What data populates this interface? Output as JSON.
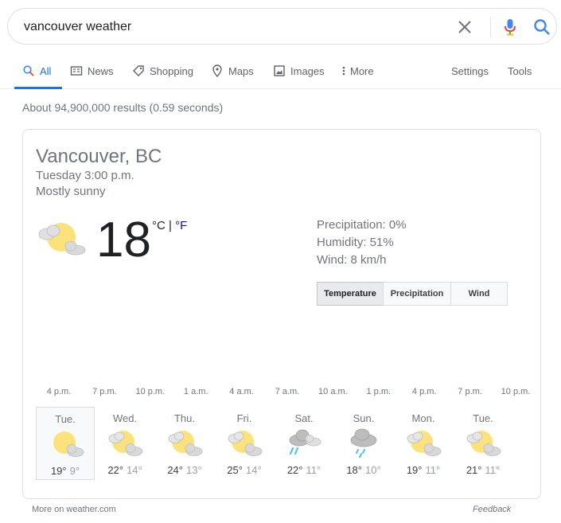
{
  "search": {
    "query": "vancouver weather"
  },
  "tabs": [
    {
      "label": "All",
      "icon": "search-icon"
    },
    {
      "label": "News",
      "icon": "news-icon"
    },
    {
      "label": "Shopping",
      "icon": "tag-icon"
    },
    {
      "label": "Maps",
      "icon": "map-pin-icon"
    },
    {
      "label": "Images",
      "icon": "image-icon"
    },
    {
      "label": "More",
      "icon": "more-vert-icon"
    }
  ],
  "tools": {
    "settings": "Settings",
    "tools": "Tools"
  },
  "result_stats": "About 94,900,000 results (0.59 seconds)",
  "weather": {
    "location": "Vancouver, BC",
    "datetime": "Tuesday 3:00 p.m.",
    "condition": "Mostly sunny",
    "temperature": "18",
    "unit_c": "°C",
    "unit_sep": " | ",
    "unit_f": "°F",
    "precipitation": "Precipitation: 0%",
    "humidity": "Humidity: 51%",
    "wind": "Wind: 8 km/h",
    "toggle": [
      "Temperature",
      "Precipitation",
      "Wind"
    ],
    "hours": [
      "4 p.m.",
      "7 p.m.",
      "10 p.m.",
      "1 a.m.",
      "4 a.m.",
      "7 a.m.",
      "10 a.m.",
      "1 p.m.",
      "4 p.m.",
      "7 p.m.",
      "10 p.m."
    ],
    "days": [
      {
        "name": "Tue.",
        "icon": "sunny-icon",
        "hi": "19°",
        "lo": "9°"
      },
      {
        "name": "Wed.",
        "icon": "partly-cloudy-icon",
        "hi": "22°",
        "lo": "14°"
      },
      {
        "name": "Thu.",
        "icon": "partly-cloudy-icon",
        "hi": "24°",
        "lo": "13°"
      },
      {
        "name": "Fri.",
        "icon": "partly-cloudy-icon",
        "hi": "25°",
        "lo": "14°"
      },
      {
        "name": "Sat.",
        "icon": "showers-icon",
        "hi": "22°",
        "lo": "11°"
      },
      {
        "name": "Sun.",
        "icon": "rain-icon",
        "hi": "18°",
        "lo": "10°"
      },
      {
        "name": "Mon.",
        "icon": "partly-cloudy-icon",
        "hi": "19°",
        "lo": "11°"
      },
      {
        "name": "Tue.",
        "icon": "partly-cloudy-icon",
        "hi": "21°",
        "lo": "11°"
      }
    ]
  },
  "footer": {
    "source": "More on weather.com",
    "feedback": "Feedback"
  },
  "colors": {
    "accent": "#1a73e8",
    "sun": "#fce27b",
    "cloud": "#d3d3d3",
    "rain": "#4fc3f7"
  }
}
